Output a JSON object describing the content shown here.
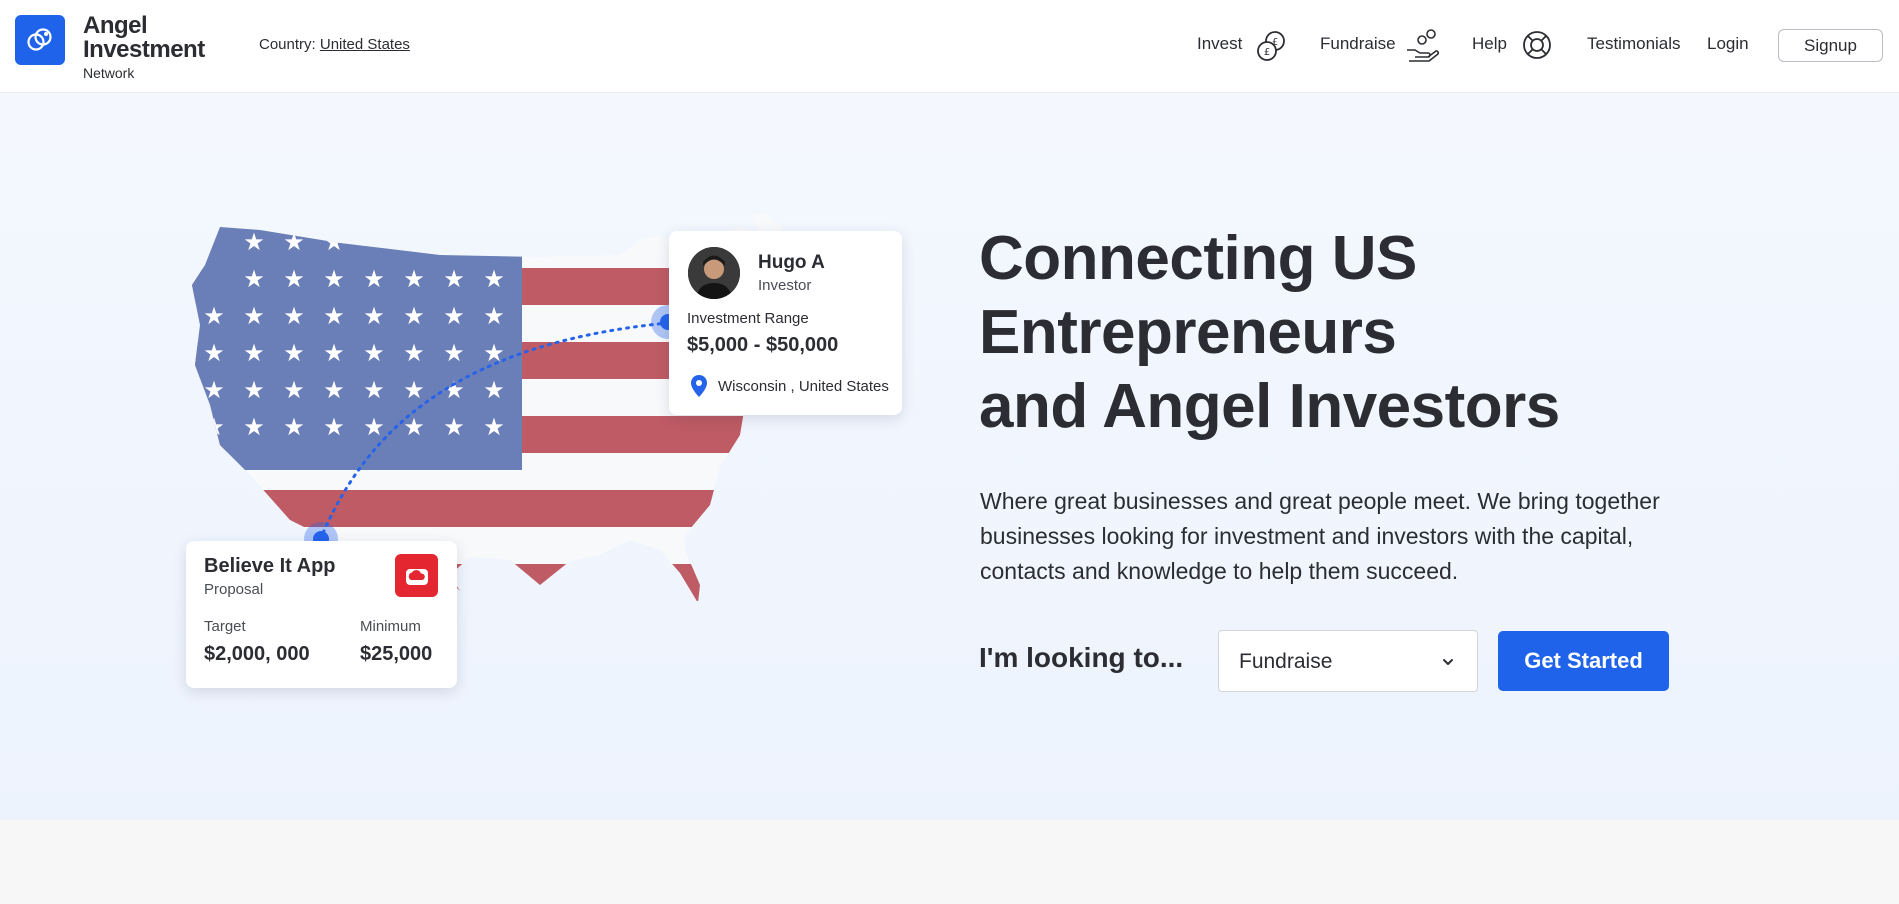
{
  "brand": {
    "line1": "Angel",
    "line2": "Investment",
    "line3": "Network",
    "accent_color": "#1e63e9"
  },
  "header": {
    "country_label": "Country:",
    "country_value": "United States",
    "nav": [
      {
        "label": "Invest",
        "icon": "coins-icon"
      },
      {
        "label": "Fundraise",
        "icon": "hand-coins-icon"
      },
      {
        "label": "Help",
        "icon": "lifebuoy-icon"
      },
      {
        "label": "Testimonials"
      },
      {
        "label": "Login"
      }
    ],
    "signup_label": "Signup"
  },
  "investor_card": {
    "name": "Hugo A",
    "role": "Investor",
    "range_label": "Investment Range",
    "range_value": "$5,000 - $50,000",
    "location": "Wisconsin , United States"
  },
  "proposal_card": {
    "title": "Believe It App",
    "subtitle": "Proposal",
    "target_label": "Target",
    "target_value": "$2,000, 000",
    "minimum_label": "Minimum",
    "minimum_value": "$25,000",
    "icon_color": "#e3262f"
  },
  "hero": {
    "title_lines": [
      "Connecting US",
      "Entrepreneurs",
      "and Angel Investors"
    ],
    "description_lines": [
      "Where great businesses and great people meet. We bring together",
      "businesses looking for investment and investors with the capital,",
      "contacts and knowledge to help them succeed."
    ],
    "looking_label": "I'm looking to...",
    "select_value": "Fundraise",
    "cta_label": "Get Started"
  }
}
